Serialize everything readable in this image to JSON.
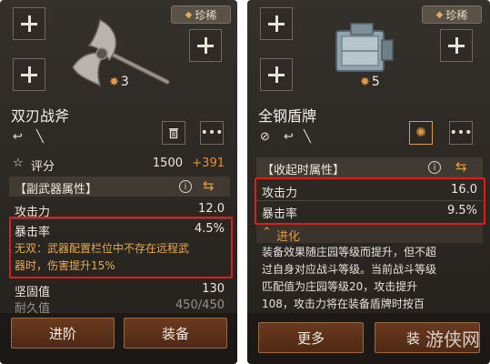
{
  "left": {
    "rarity": "珍稀",
    "star_level": "3",
    "item_name": "双刃战斧",
    "rating_label": "评分",
    "rating_base": "1500",
    "rating_bonus": "+391",
    "section_title": "【副武器属性】",
    "stats": [
      {
        "label": "攻击力",
        "value": "12.0"
      },
      {
        "label": "暴击率",
        "value": "4.5%"
      }
    ],
    "special_text_line1": "无双：武器配置栏位中不存在远程武",
    "special_text_line2": "器时，伤害提升15%",
    "stat_hardness_label": "坚固值",
    "stat_hardness_value": "130",
    "stat_partial_label": "耐久值",
    "stat_partial_value": "450/450",
    "btn_advance": "进阶",
    "btn_equip": "装备"
  },
  "right": {
    "rarity": "珍稀",
    "star_level": "5",
    "item_name": "全钢盾牌",
    "section_title": "【收起时属性】",
    "stats": [
      {
        "label": "攻击力",
        "value": "16.0"
      },
      {
        "label": "暴击率",
        "value": "9.5%"
      }
    ],
    "advance_label": "进化",
    "desc_lines": [
      "装备效果随庄园等级而提升，但不超",
      "过自身对应战斗等级。当前战斗等级",
      "匹配值为庄园等级20，攻击提升",
      "108，攻击力将在装备盾牌时按百"
    ],
    "btn_more": "更多",
    "btn_equip_partial": "装",
    "watermark": "游侠网"
  },
  "colors": {
    "accent_orange": "#e59a3c",
    "highlight_red": "#e01b1b",
    "bonus_orange": "#e9912f",
    "desc_orange": "#e7a94f"
  }
}
